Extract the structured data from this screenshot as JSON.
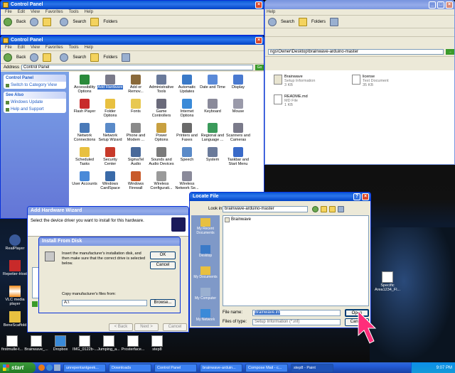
{
  "windows": {
    "cp_back": {
      "title": "Control Panel",
      "menu": [
        "File",
        "Edit",
        "View",
        "Favorites",
        "Tools",
        "Help"
      ],
      "back": "Back",
      "search": "Search",
      "folders": "Folders"
    },
    "explorer_back": {
      "menu_help": "Help",
      "search": "Search",
      "folders": "Folders",
      "address": "ngs\\Owner\\Desktop\\brainwave-arduino-master",
      "files": [
        {
          "name": "Brainwave",
          "sub1": "Setup Information",
          "sub2": "3 KB"
        },
        {
          "name": "license",
          "sub1": "Text Document",
          "sub2": "35 KB"
        },
        {
          "name": "README.md",
          "sub1": "MD File",
          "sub2": "1 KB"
        }
      ]
    },
    "cp_main": {
      "title": "Control Panel",
      "menu": [
        "File",
        "Edit",
        "View",
        "Favorites",
        "Tools",
        "Help"
      ],
      "back": "Back",
      "search": "Search",
      "folders": "Folders",
      "address_label": "Address",
      "address": "Control Panel",
      "go": "Go",
      "panel_title": "Control Panel",
      "switch": "Switch to Category View",
      "see_also": "See Also",
      "see_also_items": [
        "Windows Update",
        "Help and Support"
      ],
      "items": [
        {
          "label": "Accessibility Options",
          "color": "#2a8a3a"
        },
        {
          "label": "Add Hardware",
          "color": "#7a7a8a"
        },
        {
          "label": "Add or Remov...",
          "color": "#8a6a3a"
        },
        {
          "label": "Administrative Tools",
          "color": "#6a7a9a"
        },
        {
          "label": "Automatic Updates",
          "color": "#3a7ac8"
        },
        {
          "label": "Date and Time",
          "color": "#5a8ad8"
        },
        {
          "label": "Display",
          "color": "#4a7ad0"
        },
        {
          "label": "Flash Player",
          "color": "#c82a2a"
        },
        {
          "label": "Folder Options",
          "color": "#e8c040"
        },
        {
          "label": "Fonts",
          "color": "#e8c850"
        },
        {
          "label": "Game Controllers",
          "color": "#6a6a7a"
        },
        {
          "label": "Internet Options",
          "color": "#3a8ad8"
        },
        {
          "label": "Keyboard",
          "color": "#8a8a9a"
        },
        {
          "label": "Mouse",
          "color": "#9a9aaa"
        },
        {
          "label": "Network Connections",
          "color": "#4a7ab8"
        },
        {
          "label": "Network Setup Wizard",
          "color": "#5a8ac8"
        },
        {
          "label": "Phone and Modem ...",
          "color": "#8a8a8a"
        },
        {
          "label": "Power Options",
          "color": "#c8a040"
        },
        {
          "label": "Printers and Faxes",
          "color": "#6a6a6a"
        },
        {
          "label": "Regional and Language ...",
          "color": "#3a9a5a"
        },
        {
          "label": "Scanners and Cameras",
          "color": "#7a7a8a"
        },
        {
          "label": "Scheduled Tasks",
          "color": "#e8c040"
        },
        {
          "label": "Security Center",
          "color": "#c83a2a"
        },
        {
          "label": "SigmaTel Audio",
          "color": "#4a6a9a"
        },
        {
          "label": "Sounds and Audio Devices",
          "color": "#7a7a7a"
        },
        {
          "label": "Speech",
          "color": "#5a8ac8"
        },
        {
          "label": "System",
          "color": "#6a7a9a"
        },
        {
          "label": "Taskbar and Start Menu",
          "color": "#3a6ac8"
        },
        {
          "label": "User Accounts",
          "color": "#4a8ad8"
        },
        {
          "label": "Windows CardSpace",
          "color": "#3a6aa8"
        },
        {
          "label": "Windows Firewall",
          "color": "#c85a2a"
        },
        {
          "label": "Wireless Configurati...",
          "color": "#9a9a9a"
        },
        {
          "label": "Wireless Network Se...",
          "color": "#8a8a9a"
        }
      ]
    },
    "wizard": {
      "title": "Add Hardware Wizard",
      "heading": "Select the device driver you want to install for this hardware.",
      "back": "< Back",
      "next": "Next >",
      "cancel": "Cancel"
    },
    "install_disk": {
      "title": "Install From Disk",
      "text": "Insert the manufacturer's installation disk, and then make sure that the correct drive is selected below.",
      "ok": "OK",
      "cancel": "Cancel",
      "copy_label": "Copy manufacturer's files from:",
      "copy_value": "A:\\",
      "browse": "Browse..."
    },
    "locate": {
      "title": "Locate File",
      "look_in_label": "Look in:",
      "look_in": "brainwave-arduino-master",
      "file_item": "Brainwave",
      "places": [
        "My Recent Documents",
        "Desktop",
        "My Documents",
        "My Computer",
        "My Network"
      ],
      "file_name_label": "File name:",
      "file_name": "Brainwave.inf",
      "files_of_type_label": "Files of type:",
      "files_of_type": "Setup Information (*.inf)",
      "open": "Open",
      "cancel": "Cancel"
    }
  },
  "desktop_icons": [
    "RealPlayer",
    "Repetier-Host",
    "VLC media player",
    "BeneScaffold",
    "Specific Area1234_Fl..."
  ],
  "desktop_icons_bottom": [
    "firstmulle-t...",
    "Brainwave_...",
    "Dropbox",
    "IMG_0122b-...",
    "Jumping_a...",
    "Prosterface...",
    "step8"
  ],
  "taskbar": {
    "start": "start",
    "tasks": [
      "unrepentantgeek...",
      "Downloads",
      "Control Panel",
      "brainwave-arduin...",
      "Compose Mail - c...",
      "step8 - Paint"
    ],
    "clock": "9:07 PM"
  }
}
